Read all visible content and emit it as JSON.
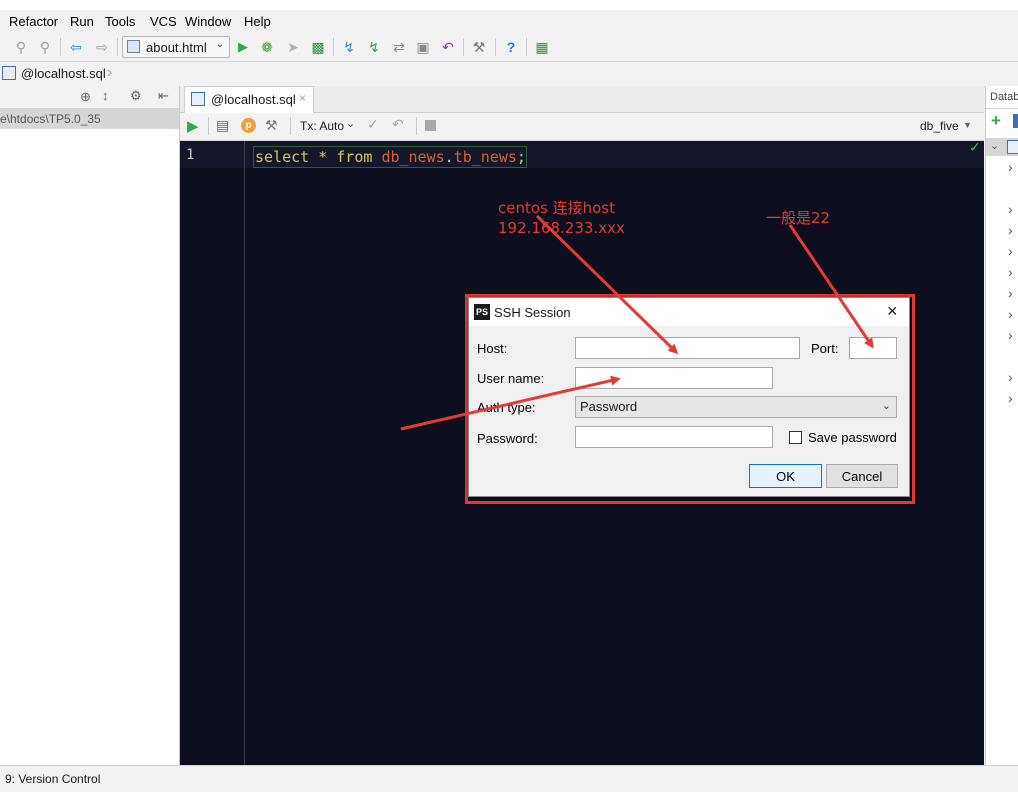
{
  "menu": {
    "items": [
      "Refactor",
      "Run",
      "Tools",
      "VCS",
      "Window",
      "Help"
    ]
  },
  "toolbar": {
    "run_config": "about.html"
  },
  "breadcrumb": {
    "file": "@localhost.sql"
  },
  "left_panel": {
    "path": "e\\htdocs\\TP5.0_35"
  },
  "editor": {
    "tab_label": "@localhost.sql",
    "tx_mode": "Tx: Auto",
    "schema": "db_five",
    "line_number": "1",
    "code": {
      "kw_select": "select",
      "star": " * ",
      "kw_from": "from",
      "space": " ",
      "schema": "db_news",
      "dot": ".",
      "table": "tb_news",
      "semi": ";"
    }
  },
  "right_panel": {
    "title": "Datab"
  },
  "statusbar": {
    "version_control": "9: Version Control"
  },
  "dialog": {
    "title": "SSH Session",
    "ps_badge": "PS",
    "host_label": "Host:",
    "host_value": "",
    "port_label": "Port:",
    "port_value": "",
    "username_label": "User name:",
    "username_value": "",
    "authtype_label": "Auth type:",
    "authtype_value": "Password",
    "password_label": "Password:",
    "password_value": "",
    "save_password_label": "Save password",
    "ok_label": "OK",
    "cancel_label": "Cancel"
  },
  "annotations": {
    "host_note_line1": "centos 连接host",
    "host_note_line2": "192.168.233.xxx",
    "port_note": "一般是22",
    "color": "#e53935"
  },
  "colors": {
    "editor_bg": "#0d0f1e",
    "keyword": "#d6c74a",
    "identifier": "#d9622b"
  }
}
